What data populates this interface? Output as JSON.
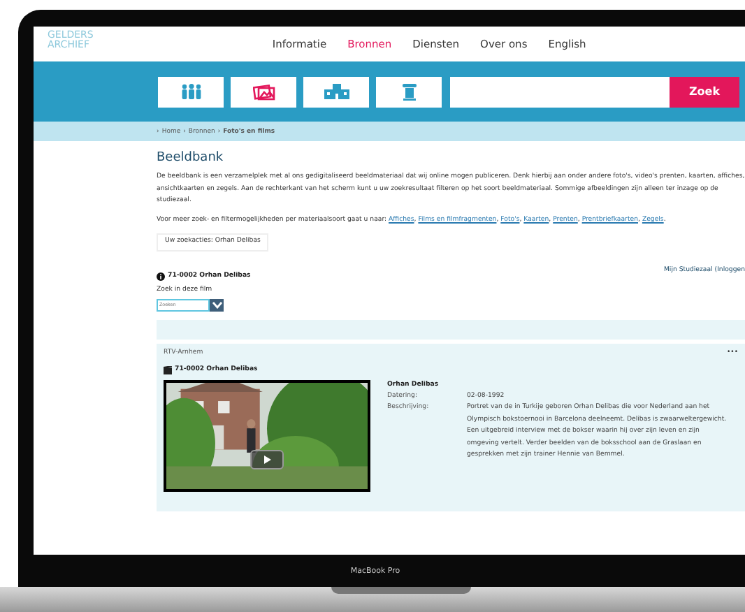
{
  "logo": [
    "GELDERS",
    "ARCHIEF"
  ],
  "nav": [
    {
      "label": "Informatie",
      "selected": false
    },
    {
      "label": "Bronnen",
      "selected": true
    },
    {
      "label": "Diensten",
      "selected": false
    },
    {
      "label": "Over ons",
      "selected": false
    },
    {
      "label": "English",
      "selected": false
    }
  ],
  "category_buttons": [
    {
      "kind": "people"
    },
    {
      "kind": "photos"
    },
    {
      "kind": "building"
    },
    {
      "kind": "column"
    }
  ],
  "search": {
    "button": "Zoek"
  },
  "breadcrumb": {
    "separator": "›",
    "items": [
      {
        "label": "Home",
        "selected": false
      },
      {
        "label": "Bronnen",
        "selected": false
      },
      {
        "label": "Foto's en films",
        "selected": true
      }
    ]
  },
  "heading": "Beeldbank",
  "intro": "De beeldbank is een verzamelplek met al ons gedigitaliseerd beeldmateriaal dat wij online mogen publiceren. Denk hierbij aan onder andere foto's, video's prenten, kaarten, affiches, ansichtkaarten en zegels. Aan de rechterkant van het scherm kunt u uw zoekresultaat filteren op het soort beeldmateriaal. Sommige afbeeldingen zijn alleen ter inzage op de studiezaal.",
  "more_info": {
    "text": "Voor meer zoek- en filtermogelijkheden per materiaalsoort gaat u naar:",
    "links": [
      {
        "label": "Affiches",
        "after": ","
      },
      {
        "label": "Films en filmfragmenten",
        "after": ","
      },
      {
        "label": "Foto's",
        "after": ","
      },
      {
        "label": "Kaarten",
        "after": ","
      },
      {
        "label": "Prenten",
        "after": ","
      },
      {
        "label": "Prentbriefkaarten",
        "after": ","
      },
      {
        "label": "Zegels",
        "after": "."
      }
    ]
  },
  "search_history": "Uw zoekacties: Orhan Delibas",
  "record_title": "71-0002 Orhan Delibas",
  "login_link": "Mijn Studiezaal (Inloggen",
  "film_search": {
    "label": "Zoek in deze film",
    "placeholder": "Zoeken"
  },
  "result": {
    "source": "RTV-Arnhem",
    "more": "•••",
    "title": "71-0002 Orhan Delibas",
    "name": "Orhan Delibas",
    "fields": [
      {
        "label": "Datering:",
        "value": "02-08-1992"
      },
      {
        "label": "Beschrijving:",
        "value": "Portret van de in Turkije geboren Orhan Delibas die voor Nederland aan het Olympisch bokstoernooi in Barcelona deelneemt. Delibas is zwaarweltergewicht. Een uitgebreid interview met de bokser waarin hij over zijn leven en zijn omgeving vertelt. Verder beelden van de boksschool aan de Graslaan en gesprekken met zijn trainer Hennie van Bemmel."
      }
    ]
  },
  "device_label": "MacBook Pro"
}
